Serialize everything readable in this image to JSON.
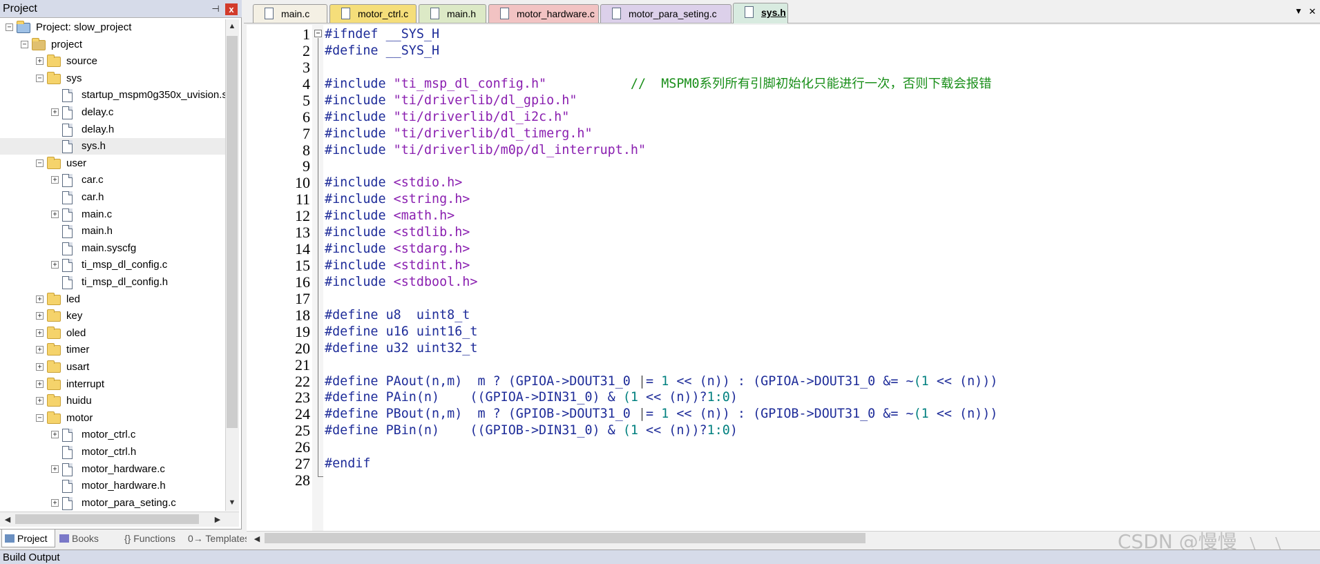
{
  "project_panel": {
    "title": "Project",
    "pin_glyph": "⊣",
    "close_glyph": "x",
    "tree": [
      {
        "label": "Project: slow_project",
        "kind": "root",
        "icon": "project-root-icon",
        "toggle": "−"
      },
      {
        "label": "project",
        "kind": "target",
        "icon": "target-icon",
        "toggle": "−"
      },
      {
        "label": "source",
        "kind": "folder",
        "icon": "folder-icon",
        "toggle": "+"
      },
      {
        "label": "sys",
        "kind": "folder-open",
        "icon": "folder-open-icon",
        "toggle": "−"
      },
      {
        "label": "startup_mspm0g350x_uvision.s",
        "kind": "file",
        "icon": "file-icon",
        "toggle": ""
      },
      {
        "label": "delay.c",
        "kind": "file",
        "icon": "file-icon",
        "toggle": "+"
      },
      {
        "label": "delay.h",
        "kind": "file",
        "icon": "file-icon",
        "toggle": ""
      },
      {
        "label": "sys.h",
        "kind": "file",
        "icon": "file-icon",
        "toggle": "",
        "selected": true
      },
      {
        "label": "user",
        "kind": "folder-open",
        "icon": "folder-open-icon",
        "toggle": "−"
      },
      {
        "label": "car.c",
        "kind": "file",
        "icon": "file-icon",
        "toggle": "+"
      },
      {
        "label": "car.h",
        "kind": "file",
        "icon": "file-icon",
        "toggle": ""
      },
      {
        "label": "main.c",
        "kind": "file",
        "icon": "file-icon",
        "toggle": "+"
      },
      {
        "label": "main.h",
        "kind": "file",
        "icon": "file-icon",
        "toggle": ""
      },
      {
        "label": "main.syscfg",
        "kind": "file",
        "icon": "file-icon",
        "toggle": ""
      },
      {
        "label": "ti_msp_dl_config.c",
        "kind": "file",
        "icon": "file-icon",
        "toggle": "+"
      },
      {
        "label": "ti_msp_dl_config.h",
        "kind": "file",
        "icon": "file-icon",
        "toggle": ""
      },
      {
        "label": "led",
        "kind": "folder",
        "icon": "folder-icon",
        "toggle": "+"
      },
      {
        "label": "key",
        "kind": "folder",
        "icon": "folder-icon",
        "toggle": "+"
      },
      {
        "label": "oled",
        "kind": "folder",
        "icon": "folder-icon",
        "toggle": "+"
      },
      {
        "label": "timer",
        "kind": "folder",
        "icon": "folder-icon",
        "toggle": "+"
      },
      {
        "label": "usart",
        "kind": "folder",
        "icon": "folder-icon",
        "toggle": "+"
      },
      {
        "label": "interrupt",
        "kind": "folder",
        "icon": "folder-icon",
        "toggle": "+"
      },
      {
        "label": "huidu",
        "kind": "folder",
        "icon": "folder-icon",
        "toggle": "+"
      },
      {
        "label": "motor",
        "kind": "folder-open",
        "icon": "folder-open-icon",
        "toggle": "−"
      },
      {
        "label": "motor_ctrl.c",
        "kind": "file",
        "icon": "file-icon",
        "toggle": "+"
      },
      {
        "label": "motor_ctrl.h",
        "kind": "file",
        "icon": "file-icon",
        "toggle": ""
      },
      {
        "label": "motor_hardware.c",
        "kind": "file",
        "icon": "file-icon",
        "toggle": "+"
      },
      {
        "label": "motor_hardware.h",
        "kind": "file",
        "icon": "file-icon",
        "toggle": ""
      },
      {
        "label": "motor_para_seting.c",
        "kind": "file",
        "icon": "file-icon",
        "toggle": "+"
      }
    ],
    "bottom_tabs": [
      {
        "label": "Project",
        "icon": "project-tab-icon",
        "active": true
      },
      {
        "label": "Books",
        "icon": "books-icon",
        "active": false
      },
      {
        "label": "{} Functions",
        "icon": "functions-icon",
        "active": false
      },
      {
        "label": "0→ Templates",
        "icon": "templates-icon",
        "active": false
      }
    ]
  },
  "editor_tabs": [
    {
      "label": "main.c",
      "color": "#f4f0e4",
      "active": false
    },
    {
      "label": "motor_ctrl.c",
      "color": "#f5de7a",
      "active": false
    },
    {
      "label": "main.h",
      "color": "#dce9c6",
      "active": false
    },
    {
      "label": "motor_hardware.c",
      "color": "#f2c3c3",
      "active": false
    },
    {
      "label": "motor_para_seting.c",
      "color": "#dcd0ea",
      "active": false
    },
    {
      "label": "sys.h",
      "color": "#d8ebe0",
      "active": true
    }
  ],
  "tab_controls": {
    "dropdown_glyph": "▼",
    "close_glyph": "✕"
  },
  "code_lines": [
    [
      [
        "pp",
        "#ifndef __SYS_H"
      ]
    ],
    [
      [
        "pp",
        "#define __SYS_H"
      ]
    ],
    [],
    [
      [
        "pp",
        "#include "
      ],
      [
        "st",
        "\"ti_msp_dl_config.h\""
      ],
      [
        "",
        "           "
      ],
      [
        "cm",
        "//  MSPM0系列所有引脚初始化只能进行一次，否则下载会报错"
      ]
    ],
    [
      [
        "pp",
        "#include "
      ],
      [
        "st",
        "\"ti/driverlib/dl_gpio.h\""
      ]
    ],
    [
      [
        "pp",
        "#include "
      ],
      [
        "st",
        "\"ti/driverlib/dl_i2c.h\""
      ]
    ],
    [
      [
        "pp",
        "#include "
      ],
      [
        "st",
        "\"ti/driverlib/dl_timerg.h\""
      ]
    ],
    [
      [
        "pp",
        "#include "
      ],
      [
        "st",
        "\"ti/driverlib/m0p/dl_interrupt.h\""
      ]
    ],
    [],
    [
      [
        "pp",
        "#include "
      ],
      [
        "st",
        "<stdio.h>"
      ]
    ],
    [
      [
        "pp",
        "#include "
      ],
      [
        "st",
        "<string.h>"
      ]
    ],
    [
      [
        "pp",
        "#include "
      ],
      [
        "st",
        "<math.h>"
      ]
    ],
    [
      [
        "pp",
        "#include "
      ],
      [
        "st",
        "<stdlib.h>"
      ]
    ],
    [
      [
        "pp",
        "#include "
      ],
      [
        "st",
        "<stdarg.h>"
      ]
    ],
    [
      [
        "pp",
        "#include "
      ],
      [
        "st",
        "<stdint.h>"
      ]
    ],
    [
      [
        "pp",
        "#include "
      ],
      [
        "st",
        "<stdbool.h>"
      ]
    ],
    [],
    [
      [
        "pp",
        "#define u8  uint8_t"
      ]
    ],
    [
      [
        "pp",
        "#define u16 uint16_t"
      ]
    ],
    [
      [
        "pp",
        "#define u32 uint32_t"
      ]
    ],
    [],
    [
      [
        "pp",
        "#define PAout(n,m)  m ? (GPIOA->DOUT31_0 "
      ],
      [
        "op",
        "|"
      ],
      [
        "pp",
        "= "
      ],
      [
        "nm",
        "1"
      ],
      [
        "pp",
        " << (n)) : (GPIOA->DOUT31_0 &= ~"
      ],
      [
        "nm",
        "(1"
      ],
      [
        "pp",
        " << (n)))"
      ]
    ],
    [
      [
        "pp",
        "#define PAin(n)    ((GPIOA->DIN31_0) & "
      ],
      [
        "nm",
        "(1"
      ],
      [
        "pp",
        " << (n))?"
      ],
      [
        "nm",
        "1:0"
      ],
      [
        "pp",
        ")"
      ]
    ],
    [
      [
        "pp",
        "#define PBout(n,m)  m ? (GPIOB->DOUT31_0 "
      ],
      [
        "op",
        "|"
      ],
      [
        "pp",
        "= "
      ],
      [
        "nm",
        "1"
      ],
      [
        "pp",
        " << (n)) : (GPIOB->DOUT31_0 &= ~"
      ],
      [
        "nm",
        "(1"
      ],
      [
        "pp",
        " << (n)))"
      ]
    ],
    [
      [
        "pp",
        "#define PBin(n)    ((GPIOB->DIN31_0) & "
      ],
      [
        "nm",
        "(1"
      ],
      [
        "pp",
        " << (n))?"
      ],
      [
        "nm",
        "1:0"
      ],
      [
        "pp",
        ")"
      ]
    ],
    [],
    [
      [
        "pp",
        "#endif"
      ]
    ],
    []
  ],
  "build_output": {
    "title": "Build Output"
  },
  "watermark": "CSDN @慢慢 ﹨ ﹨"
}
